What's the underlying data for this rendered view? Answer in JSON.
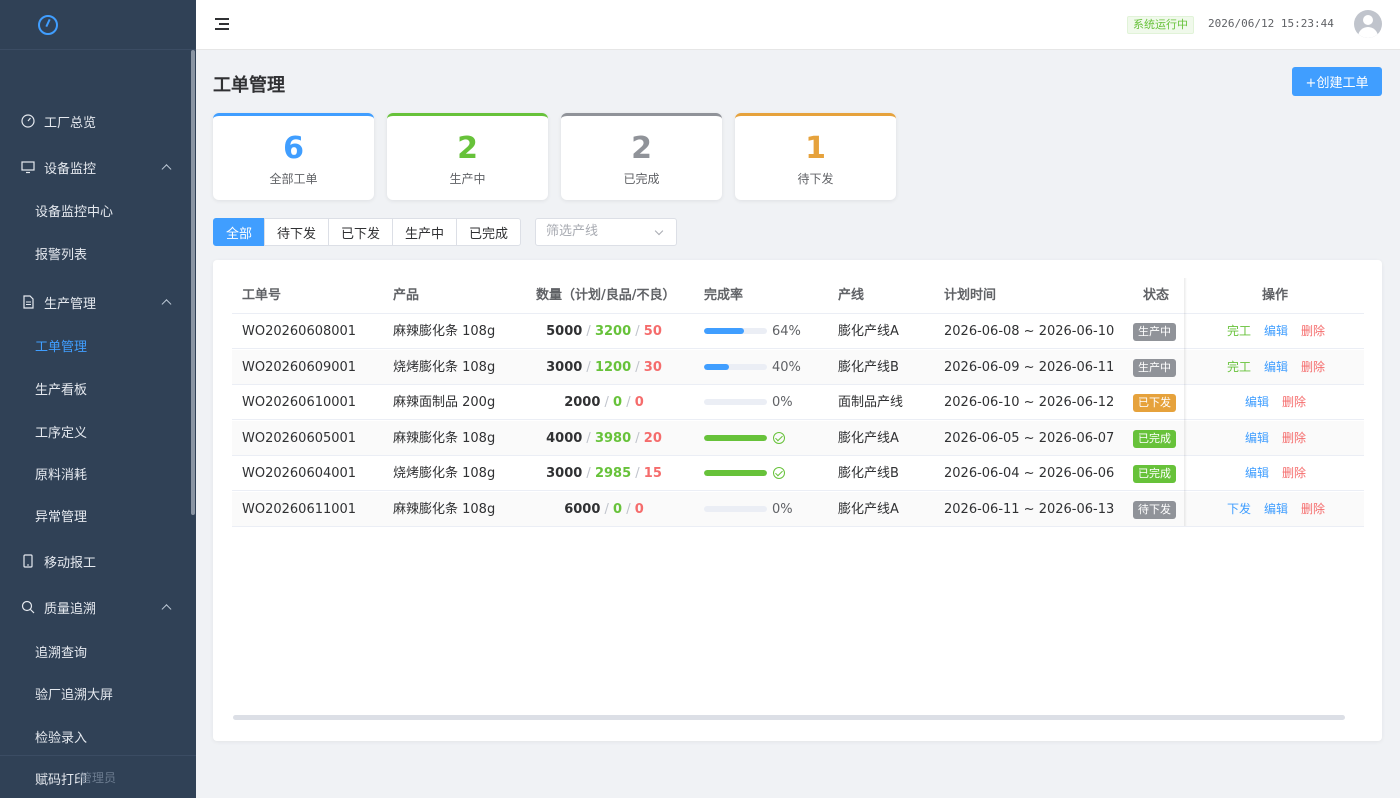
{
  "sidebar": {
    "top_items": [
      {
        "label": "工厂总览",
        "icon": "dashboard-icon"
      },
      {
        "label": "设备监控",
        "icon": "monitor-icon"
      },
      {
        "label": "生产管理",
        "icon": "document-icon"
      },
      {
        "label": "移动报工",
        "icon": "mobile-icon"
      },
      {
        "label": "质量追溯",
        "icon": "search-icon"
      }
    ],
    "sub_items": [
      {
        "label": "设备监控中心"
      },
      {
        "label": "报警列表"
      },
      {
        "label": "工单管理",
        "active": true
      },
      {
        "label": "生产看板"
      },
      {
        "label": "工序定义"
      },
      {
        "label": "原料消耗"
      },
      {
        "label": "异常管理"
      },
      {
        "label": "追溯查询"
      },
      {
        "label": "验厂追溯大屏"
      },
      {
        "label": "检验录入"
      },
      {
        "label": "赋码打印"
      }
    ],
    "footer": "管理员"
  },
  "header": {
    "status": "系统运行中",
    "datetime": "2026/06/12 15:23:44"
  },
  "page": {
    "title": "工单管理",
    "create_button": "+创建工单"
  },
  "stats": [
    {
      "value": "6",
      "label": "全部工单",
      "color": "#409eff"
    },
    {
      "value": "2",
      "label": "生产中",
      "color": "#67c23a"
    },
    {
      "value": "2",
      "label": "已完成",
      "color": "#909399"
    },
    {
      "value": "1",
      "label": "待下发",
      "color": "#e6a23c"
    }
  ],
  "filter_tabs": [
    {
      "label": "全部",
      "active": true
    },
    {
      "label": "待下发"
    },
    {
      "label": "已下发"
    },
    {
      "label": "生产中"
    },
    {
      "label": "已完成"
    }
  ],
  "line_filter": {
    "placeholder": "筛选产线"
  },
  "table": {
    "headers": {
      "order_no": "工单号",
      "product": "产品",
      "qty": "数量（计划/良品/不良）",
      "progress": "完成率",
      "line": "产线",
      "plan_time": "计划时间",
      "status": "状态",
      "actions": "操作"
    },
    "rows": [
      {
        "order_no": "WO20260608001",
        "product": "麻辣膨化条 108g",
        "plan": "5000",
        "good": "3200",
        "bad": "50",
        "progress": 64,
        "progress_text": "64%",
        "progress_color": "#409eff",
        "done": false,
        "line": "膨化产线A",
        "plan_time": "2026-06-08 ~ 2026-06-10",
        "status": "生产中",
        "status_color": "#909399",
        "actions": [
          {
            "label": "完工",
            "tone": "green"
          },
          {
            "label": "编辑",
            "tone": "blue"
          },
          {
            "label": "删除",
            "tone": "red"
          }
        ]
      },
      {
        "order_no": "WO20260609001",
        "product": "烧烤膨化条 108g",
        "plan": "3000",
        "good": "1200",
        "bad": "30",
        "progress": 40,
        "progress_text": "40%",
        "progress_color": "#409eff",
        "done": false,
        "line": "膨化产线B",
        "plan_time": "2026-06-09 ~ 2026-06-11",
        "status": "生产中",
        "status_color": "#909399",
        "actions": [
          {
            "label": "完工",
            "tone": "green"
          },
          {
            "label": "编辑",
            "tone": "blue"
          },
          {
            "label": "删除",
            "tone": "red"
          }
        ]
      },
      {
        "order_no": "WO20260610001",
        "product": "麻辣面制品 200g",
        "plan": "2000",
        "good": "0",
        "bad": "0",
        "progress": 0,
        "progress_text": "0%",
        "progress_color": "#409eff",
        "done": false,
        "line": "面制品产线",
        "plan_time": "2026-06-10 ~ 2026-06-12",
        "status": "已下发",
        "status_color": "#e6a23c",
        "actions": [
          {
            "label": "编辑",
            "tone": "blue"
          },
          {
            "label": "删除",
            "tone": "red"
          }
        ]
      },
      {
        "order_no": "WO20260605001",
        "product": "麻辣膨化条 108g",
        "plan": "4000",
        "good": "3980",
        "bad": "20",
        "progress": 100,
        "progress_text": "",
        "progress_color": "#67c23a",
        "done": true,
        "line": "膨化产线A",
        "plan_time": "2026-06-05 ~ 2026-06-07",
        "status": "已完成",
        "status_color": "#67c23a",
        "actions": [
          {
            "label": "编辑",
            "tone": "blue"
          },
          {
            "label": "删除",
            "tone": "red"
          }
        ]
      },
      {
        "order_no": "WO20260604001",
        "product": "烧烤膨化条 108g",
        "plan": "3000",
        "good": "2985",
        "bad": "15",
        "progress": 100,
        "progress_text": "",
        "progress_color": "#67c23a",
        "done": true,
        "line": "膨化产线B",
        "plan_time": "2026-06-04 ~ 2026-06-06",
        "status": "已完成",
        "status_color": "#67c23a",
        "actions": [
          {
            "label": "编辑",
            "tone": "blue"
          },
          {
            "label": "删除",
            "tone": "red"
          }
        ]
      },
      {
        "order_no": "WO20260611001",
        "product": "麻辣膨化条 108g",
        "plan": "6000",
        "good": "0",
        "bad": "0",
        "progress": 0,
        "progress_text": "0%",
        "progress_color": "#409eff",
        "done": false,
        "line": "膨化产线A",
        "plan_time": "2026-06-11 ~ 2026-06-13",
        "status": "待下发",
        "status_color": "#909399",
        "actions": [
          {
            "label": "下发",
            "tone": "blue"
          },
          {
            "label": "编辑",
            "tone": "blue"
          },
          {
            "label": "删除",
            "tone": "red"
          }
        ]
      }
    ]
  }
}
